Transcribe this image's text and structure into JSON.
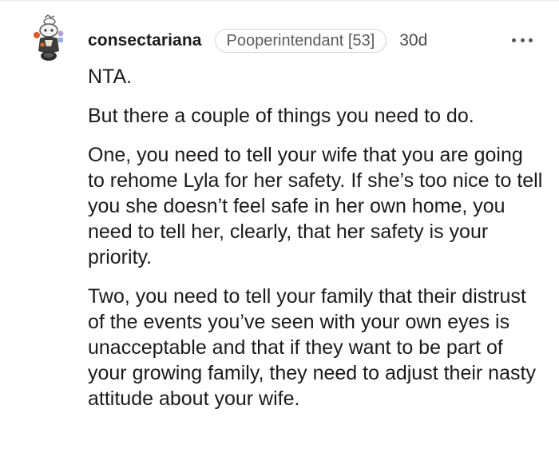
{
  "comment": {
    "author": "consectariana",
    "flair": "Pooperintendant [53]",
    "age": "30d",
    "paragraphs": [
      "NTA.",
      "But there a couple of things you need to do.",
      "One, you need to tell your wife that you are going to rehome Lyla for her safety. If she’s too nice to tell you she doesn’t feel safe in her own home, you need to tell her, clearly, that her safety is your priority.",
      "Two, you need to tell your family that their distrust of the events you’ve seen with your own eyes is unacceptable and that if they want to be part of your growing family, they need to adjust their nasty attitude about your wife."
    ]
  },
  "icons": {
    "avatar": "snoo-avatar-icon",
    "more": "more-options-icon"
  }
}
